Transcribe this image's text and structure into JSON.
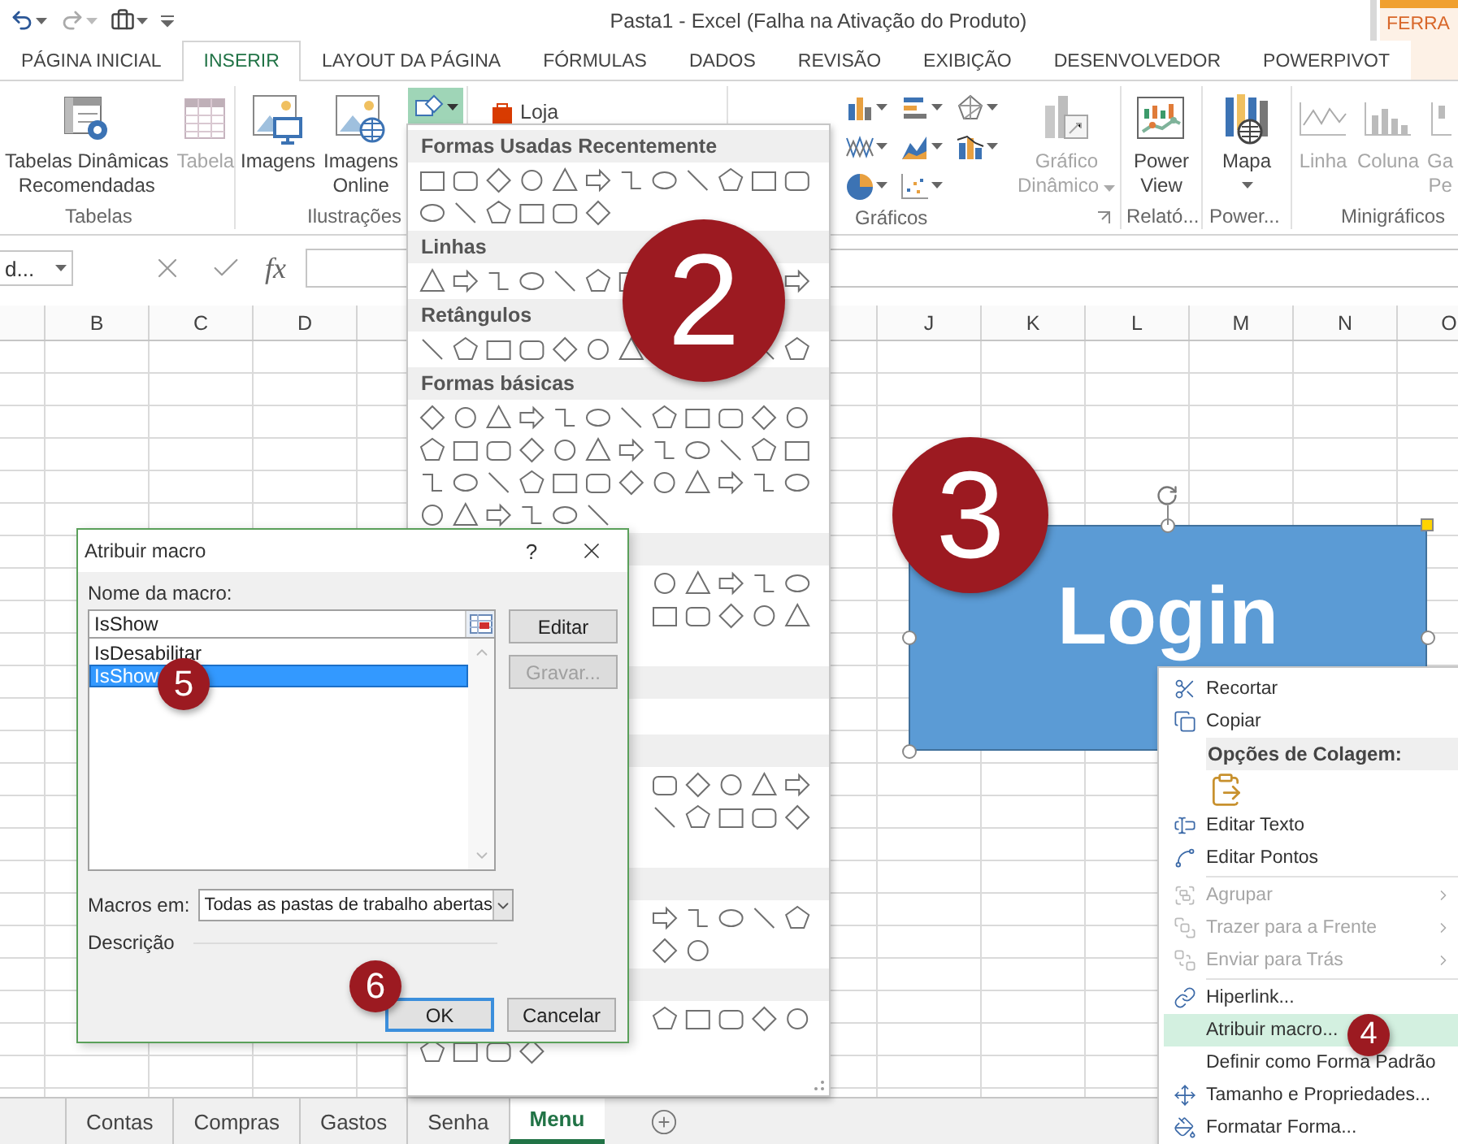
{
  "title_bar": {
    "title": "Pasta1 - Excel (Falha na Ativação do Produto)",
    "context_tab": "FERRA"
  },
  "tabs": [
    {
      "label": "PÁGINA INICIAL",
      "selected": false
    },
    {
      "label": "INSERIR",
      "selected": true
    },
    {
      "label": "LAYOUT DA PÁGINA",
      "selected": false
    },
    {
      "label": "FÓRMULAS",
      "selected": false
    },
    {
      "label": "DADOS",
      "selected": false
    },
    {
      "label": "REVISÃO",
      "selected": false
    },
    {
      "label": "EXIBIÇÃO",
      "selected": false
    },
    {
      "label": "DESENVOLVEDOR",
      "selected": false
    },
    {
      "label": "POWERPIVOT",
      "selected": false
    }
  ],
  "ribbon_groups": [
    {
      "kind": "tables",
      "label": "Tabelas",
      "buttons": [
        {
          "lines": [
            "Tabelas Dinâmicas",
            "Recomendadas"
          ],
          "disabled": false,
          "dropdown": false
        },
        {
          "lines": [
            "Tabela"
          ],
          "disabled": true,
          "dropdown": false
        }
      ]
    },
    {
      "kind": "illustrations",
      "label": "Ilustrações",
      "buttons": [
        {
          "lines": [
            "Imagens"
          ],
          "disabled": false,
          "dropdown": false
        },
        {
          "lines": [
            "Imagens",
            "Online"
          ],
          "disabled": false,
          "dropdown": false
        }
      ],
      "shapes_button": {
        "selected": true
      }
    },
    {
      "kind": "addins",
      "small_buttons": [
        {
          "label": "Loja"
        }
      ]
    },
    {
      "kind": "charts",
      "label": "Gráficos",
      "buttons": [
        {
          "lines": [
            "Gráfico",
            "Dinâmico"
          ],
          "disabled": true,
          "dropdown": true
        }
      ]
    },
    {
      "kind": "reports",
      "label": "Relató...",
      "buttons": [
        {
          "lines": [
            "Power",
            "View"
          ],
          "disabled": false,
          "dropdown": false
        }
      ]
    },
    {
      "kind": "maps",
      "label": "Power...",
      "buttons": [
        {
          "lines": [
            "Mapa"
          ],
          "disabled": false,
          "dropdown": true
        }
      ]
    },
    {
      "kind": "sparklines",
      "label": "Minigráficos",
      "buttons": [
        {
          "lines": [
            "Linha"
          ],
          "disabled": true,
          "dropdown": false
        },
        {
          "lines": [
            "Coluna"
          ],
          "disabled": true,
          "dropdown": false
        },
        {
          "lines": [
            "Ga",
            "Pe"
          ],
          "disabled": true,
          "dropdown": false
        }
      ]
    }
  ],
  "formula_bar": {
    "name_box": "d...",
    "function_label": "fx"
  },
  "sheet": {
    "columns_left": [
      "B",
      "C",
      "D"
    ],
    "columns_right": [
      "J",
      "K",
      "L",
      "M",
      "N",
      "O"
    ]
  },
  "shape": {
    "text": "Login"
  },
  "shapes_gallery": {
    "sections": [
      {
        "kind": "titled",
        "title": "Formas Usadas Recentemente"
      },
      {
        "kind": "titled",
        "title": "Linhas"
      },
      {
        "kind": "titled",
        "title": "Retângulos"
      },
      {
        "kind": "titled",
        "title": "Formas básicas"
      },
      {
        "kind": "covered"
      },
      {
        "kind": "covered"
      },
      {
        "kind": "covered"
      },
      {
        "kind": "covered"
      },
      {
        "kind": "covered"
      }
    ]
  },
  "dialog": {
    "title": "Atribuir macro",
    "help": "?",
    "name_label": "Nome da macro:",
    "name_value": "IsShow",
    "macros": [
      {
        "label": "IsDesabilitar",
        "selected": false
      },
      {
        "label": "IsShow",
        "selected": true
      }
    ],
    "side_buttons": [
      {
        "label": "Editar",
        "disabled": false
      },
      {
        "label": "Gravar...",
        "disabled": true
      }
    ],
    "macros_in_label": "Macros em:",
    "macros_in_value": "Todas as pastas de trabalho abertas",
    "description_label": "Descrição",
    "buttons": [
      {
        "label": "OK",
        "focused": true
      },
      {
        "label": "Cancelar",
        "focused": false
      }
    ]
  },
  "context_menu": {
    "items": [
      {
        "kind": "item",
        "label": "Recortar",
        "disabled": false,
        "submenu": false,
        "highlighted": false
      },
      {
        "kind": "item",
        "label": "Copiar",
        "disabled": false,
        "submenu": false,
        "highlighted": false
      },
      {
        "kind": "header",
        "label": "Opções de Colagem:"
      },
      {
        "kind": "paste_options"
      },
      {
        "kind": "item",
        "label": "Editar Texto",
        "disabled": false,
        "submenu": false,
        "highlighted": false
      },
      {
        "kind": "item",
        "label": "Editar Pontos",
        "disabled": false,
        "submenu": false,
        "highlighted": false
      },
      {
        "kind": "separator"
      },
      {
        "kind": "item",
        "label": "Agrupar",
        "disabled": true,
        "submenu": true,
        "highlighted": false
      },
      {
        "kind": "item",
        "label": "Trazer para a Frente",
        "disabled": true,
        "submenu": true,
        "highlighted": false
      },
      {
        "kind": "item",
        "label": "Enviar para Trás",
        "disabled": true,
        "submenu": true,
        "highlighted": false
      },
      {
        "kind": "separator"
      },
      {
        "kind": "item",
        "label": "Hiperlink...",
        "disabled": false,
        "submenu": false,
        "highlighted": false
      },
      {
        "kind": "item",
        "label": "Atribuir macro...",
        "disabled": false,
        "submenu": false,
        "highlighted": true
      },
      {
        "kind": "item",
        "label": "Definir como Forma Padrão",
        "disabled": false,
        "submenu": false,
        "highlighted": false
      },
      {
        "kind": "item",
        "label": "Tamanho e Propriedades...",
        "disabled": false,
        "submenu": false,
        "highlighted": false
      },
      {
        "kind": "item",
        "label": "Formatar Forma...",
        "disabled": false,
        "submenu": false,
        "highlighted": false
      }
    ]
  },
  "step_markers": [
    {
      "label": "2"
    },
    {
      "label": "3"
    },
    {
      "label": "4"
    },
    {
      "label": "5"
    },
    {
      "label": "6"
    }
  ],
  "sheet_tabs": [
    {
      "label": "Contas",
      "selected": false
    },
    {
      "label": "Compras",
      "selected": false
    },
    {
      "label": "Gastos",
      "selected": false
    },
    {
      "label": "Senha",
      "selected": false
    },
    {
      "label": "Menu",
      "selected": true
    }
  ]
}
